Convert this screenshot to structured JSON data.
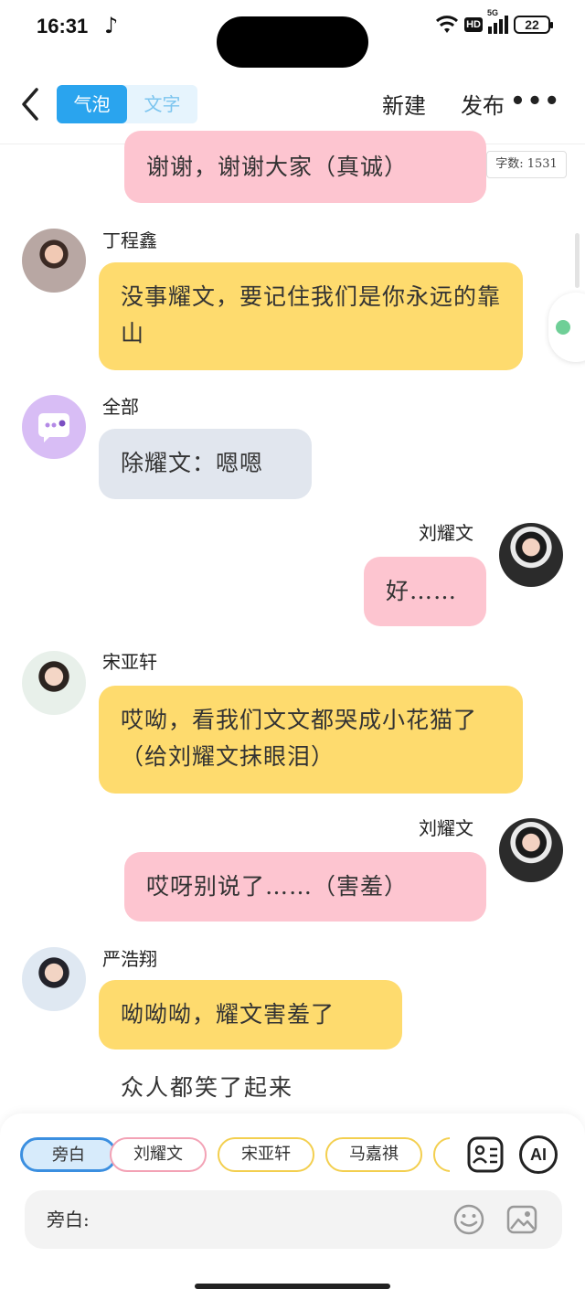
{
  "status": {
    "time": "16:31",
    "network": "5G",
    "hd": "HD",
    "battery": "22"
  },
  "nav": {
    "modes": [
      "气泡",
      "文字"
    ],
    "new_label": "新建",
    "publish_label": "发布",
    "more_label": "•••"
  },
  "word_count": "字数: 1531",
  "messages": [
    {
      "side": "right",
      "color": "pink",
      "text": "谢谢，谢谢大家（真诚）"
    },
    {
      "side": "left",
      "speaker": "丁程鑫",
      "color": "yellow",
      "text": "没事耀文，要记住我们是你永远的靠山"
    },
    {
      "side": "left",
      "speaker": "全部",
      "color": "gray",
      "text": "除耀文：嗯嗯"
    },
    {
      "side": "right",
      "speaker": "刘耀文",
      "color": "pink",
      "text": "好……"
    },
    {
      "side": "left",
      "speaker": "宋亚轩",
      "color": "yellow",
      "text": "哎呦，看我们文文都哭成小花猫了（给刘耀文抹眼泪）"
    },
    {
      "side": "right",
      "speaker": "刘耀文",
      "color": "pink",
      "text": "哎呀别说了……（害羞）"
    },
    {
      "side": "left",
      "speaker": "严浩翔",
      "color": "yellow",
      "text": "呦呦呦，耀文害羞了"
    }
  ],
  "narration": "众人都笑了起来",
  "composer": {
    "chips": [
      "旁白",
      "刘耀文",
      "宋亚轩",
      "马嘉祺"
    ],
    "chip_colors": [
      "#3b8fe0",
      "#f3a2b5",
      "#f3cf4f",
      "#f3cf4f",
      "#f3cf4f"
    ],
    "ai_label": "AI",
    "input_label": "旁白:"
  }
}
